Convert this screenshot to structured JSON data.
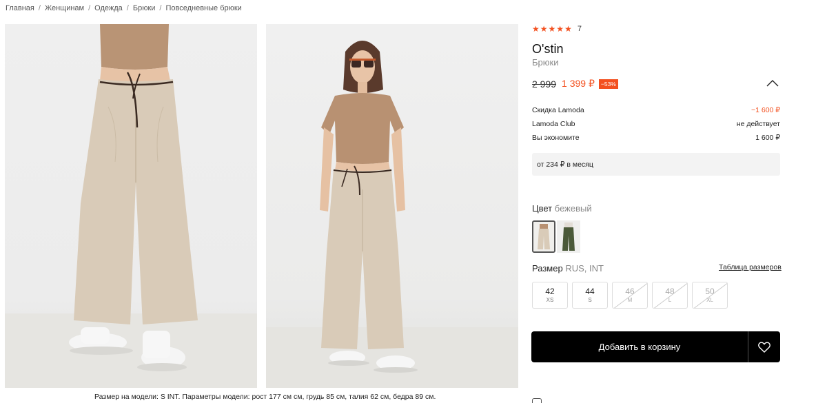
{
  "breadcrumb": [
    "Главная",
    "Женщинам",
    "Одежда",
    "Брюки",
    "Повседневные брюки"
  ],
  "gallery": {
    "caption": "Размер на модели: S INT. Параметры модели: рост 177 см см, грудь 85 см, талия 62 см, бедра 89 см."
  },
  "product": {
    "rating_stars": 5,
    "rating_count": "7",
    "brand": "O'stin",
    "category": "Брюки",
    "old_price": "2 999",
    "new_price": "1 399 ₽",
    "discount_badge": "−53%",
    "details": [
      {
        "label": "Скидка Lamoda",
        "value": "−1 600 ₽"
      },
      {
        "label": "Lamoda Club",
        "value": "не действует"
      },
      {
        "label": "Вы экономите",
        "value": "1 600 ₽"
      }
    ],
    "installment": "от 234 ₽ в месяц",
    "color_label": "Цвет",
    "color_value": "бежевый",
    "size_label": "Размер",
    "size_system": "RUS, INT",
    "size_table_link": "Таблица размеров",
    "sizes": [
      {
        "num": "42",
        "int": "XS",
        "available": true
      },
      {
        "num": "44",
        "int": "S",
        "available": true
      },
      {
        "num": "46",
        "int": "M",
        "available": false
      },
      {
        "num": "48",
        "int": "L",
        "available": false
      },
      {
        "num": "50",
        "int": "XL",
        "available": false
      }
    ],
    "add_to_cart": "Добавить в корзину"
  },
  "colors": {
    "accent": "#f3501f",
    "button_bg": "#000000",
    "pants_beige": "#d9cbb8",
    "top_tan": "#b89172",
    "swatch_green": "#4b5a3a"
  },
  "icons": {
    "star": "star-icon",
    "chevron": "chevron-up-icon",
    "favorite": "heart-icon"
  }
}
